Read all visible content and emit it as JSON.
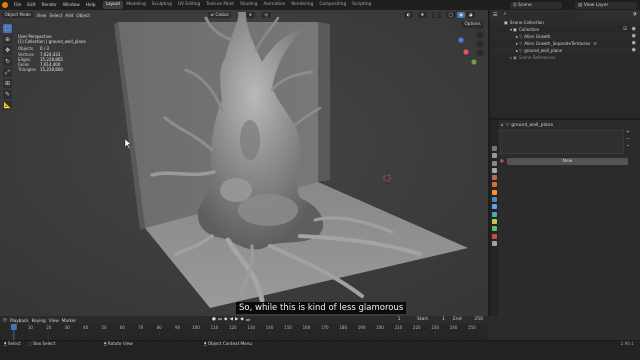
{
  "menu": [
    "File",
    "Edit",
    "Render",
    "Window",
    "Help"
  ],
  "workspaces": [
    {
      "label": "Layout",
      "active": true
    },
    {
      "label": "Modeling",
      "active": false
    },
    {
      "label": "Sculpting",
      "active": false
    },
    {
      "label": "UV Editing",
      "active": false
    },
    {
      "label": "Texture Paint",
      "active": false
    },
    {
      "label": "Shading",
      "active": false
    },
    {
      "label": "Animation",
      "active": false
    },
    {
      "label": "Rendering",
      "active": false
    },
    {
      "label": "Compositing",
      "active": false
    },
    {
      "label": "Scripting",
      "active": false
    }
  ],
  "scene": {
    "label": "Scene",
    "view_layer": "View Layer"
  },
  "viewport": {
    "mode": "Object Mode",
    "menus": [
      "View",
      "Select",
      "Add",
      "Object"
    ],
    "orientation": "Global",
    "options": "Options",
    "perspective": "User Perspective",
    "collection_line": "(1) Collection | ground_wall_plane",
    "stats": [
      {
        "k": "Objects",
        "v": "0 / 3"
      },
      {
        "k": "Vertices",
        "v": "7,624,433"
      },
      {
        "k": "Edges",
        "v": "15,228,865"
      },
      {
        "k": "Faces",
        "v": "7,614,400"
      },
      {
        "k": "Triangles",
        "v": "15,228,800"
      }
    ],
    "subtitle": "So, while this is kind of less glamorous"
  },
  "outliner": {
    "items": [
      {
        "label": "Scene Collection",
        "indent": 0
      },
      {
        "label": "Collection",
        "indent": 1
      },
      {
        "label": "Alien Growth",
        "indent": 2
      },
      {
        "label": "Alien Growth_SeparateTentacles",
        "indent": 2
      },
      {
        "label": "ground_wall_plane",
        "indent": 2
      },
      {
        "label": "Scene References",
        "indent": 1
      }
    ]
  },
  "properties": {
    "object_name": "ground_wall_plane",
    "add_button": "New"
  },
  "timeline": {
    "menus": [
      "Playback",
      "Keying",
      "View",
      "Marker"
    ],
    "current_frame": "1",
    "start_label": "Start",
    "start": "1",
    "end_label": "End",
    "end": "250",
    "ticks": [
      "0",
      "10",
      "20",
      "30",
      "40",
      "50",
      "60",
      "70",
      "80",
      "90",
      "100",
      "110",
      "120",
      "130",
      "140",
      "150",
      "160",
      "170",
      "180",
      "190",
      "200",
      "210",
      "220",
      "230",
      "240",
      "250"
    ]
  },
  "statusbar": {
    "select": "Select",
    "box_select": "Box Select",
    "rotate_view": "Rotate View",
    "context_menu": "Object Context Menu",
    "version": "2.90.1"
  },
  "colors": {
    "accent": "#4772b3",
    "logo": "#e87d0d",
    "collection_icon": "#e08a2c",
    "mesh_icon": "#ff8c3c",
    "modifier_icon": "#5dbdcc"
  }
}
